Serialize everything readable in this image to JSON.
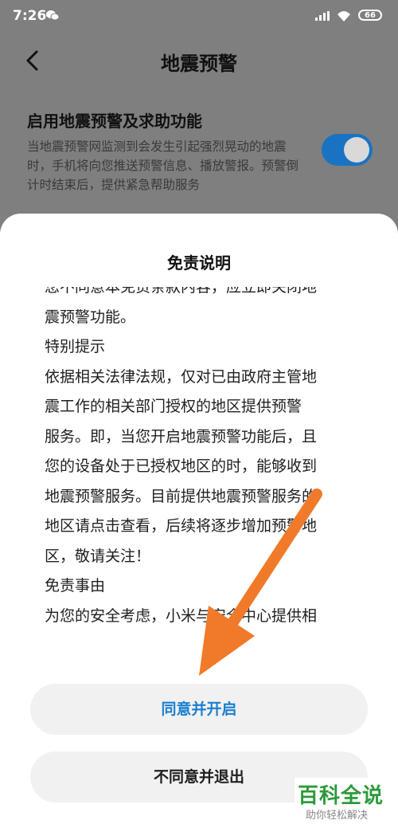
{
  "status_bar": {
    "time": "7:26",
    "battery": "66"
  },
  "header": {
    "title": "地震预警"
  },
  "setting": {
    "title": "启用地震预警及求助功能",
    "description": "当地震预警网监测到会发生引起强烈晃动的地震时，手机将向您推送预警信息、播放警报。预警倒计时结束后，提供紧急帮助服务",
    "toggle_on": true
  },
  "dialog": {
    "title": "免责说明",
    "lines": [
      "您不同意本免责条款内容，应立即关闭地",
      "震预警功能。",
      "特别提示",
      "依据相关法律法规，仅对已由政府主管地",
      "震工作的相关部门授权的地区提供预警",
      "服务。即，当您开启地震预警功能后，且",
      "您的设备处于已授权地区的时，能够收到",
      "地震预警服务。目前提供地震预警服务的",
      "地区请点击查看，后续将逐步增加预警地",
      "区，敬请关注！",
      "免责事由",
      "为您的安全考虑，小米与安全中心提供相"
    ],
    "agree_label": "同意并开启",
    "decline_label": "不同意并退出"
  },
  "colors": {
    "accent": "#1a7fd0",
    "toggle": "#1a73c2",
    "arrow": "#f07a2a"
  },
  "watermark": {
    "main": "百科全说",
    "sub": "助你轻松解决"
  }
}
